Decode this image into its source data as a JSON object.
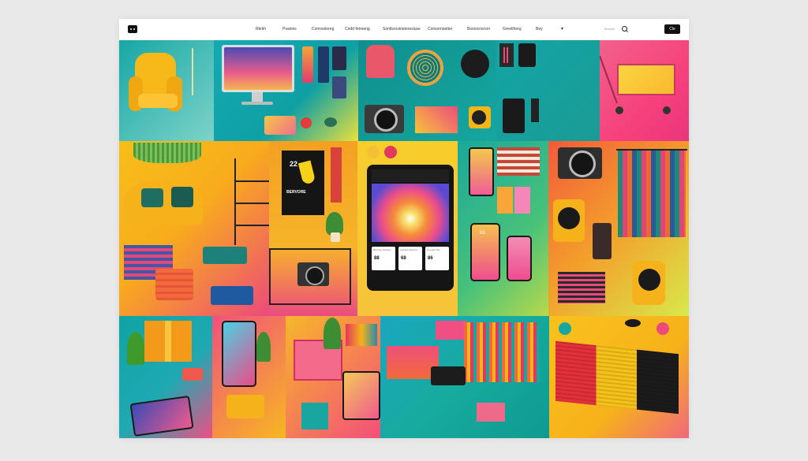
{
  "nav": {
    "items": [
      "Rkrkh",
      "Psanies",
      "Connsstoreg",
      "Cndd fetreeng",
      "Sonltsrostnetsresluse",
      "Consornsetter",
      "Bsorscnsrsrn",
      "Greeltherg",
      "Bey"
    ],
    "search_label": "Becstst",
    "cta_label": "Cle"
  },
  "poster": {
    "number": "22",
    "title": "BERVORE"
  },
  "tablet": {
    "tiles": [
      {
        "label": "Benrsey Sssersn",
        "price": "88"
      },
      {
        "label": "Lssrdea Sssrers",
        "price": "68"
      },
      {
        "label": "Losrdse Sss",
        "price": "86"
      }
    ]
  },
  "phone": {
    "label": "63"
  },
  "colors": {
    "yellow": "#f6b81c",
    "teal": "#1fb3b0",
    "magenta": "#f24d87",
    "orange": "#f6861b",
    "lime": "#b7d94a",
    "pink": "#ee4a7f"
  }
}
